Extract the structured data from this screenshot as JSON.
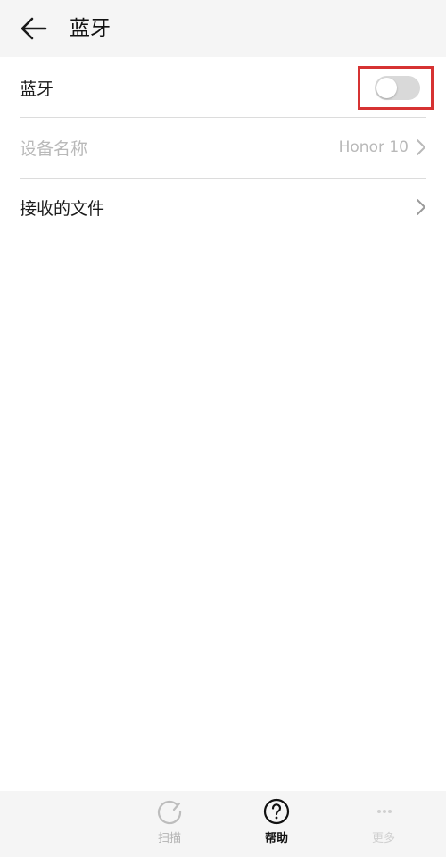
{
  "header": {
    "title": "蓝牙",
    "back_icon": "arrow-left-icon"
  },
  "settings": {
    "bluetooth": {
      "label": "蓝牙",
      "enabled": false
    },
    "device_name": {
      "label": "设备名称",
      "value": "Honor 10",
      "disabled": true
    },
    "received_files": {
      "label": "接收的文件"
    }
  },
  "bottom_bar": {
    "scan": {
      "label": "扫描",
      "icon": "refresh-icon",
      "disabled": true
    },
    "help": {
      "label": "帮助",
      "icon": "help-circle-icon"
    },
    "more": {
      "label": "更多",
      "icon": "more-icon"
    }
  },
  "colors": {
    "highlight": "#d63232",
    "toggle_off": "#d9d9d9",
    "disabled_text": "#b9b9b9"
  }
}
